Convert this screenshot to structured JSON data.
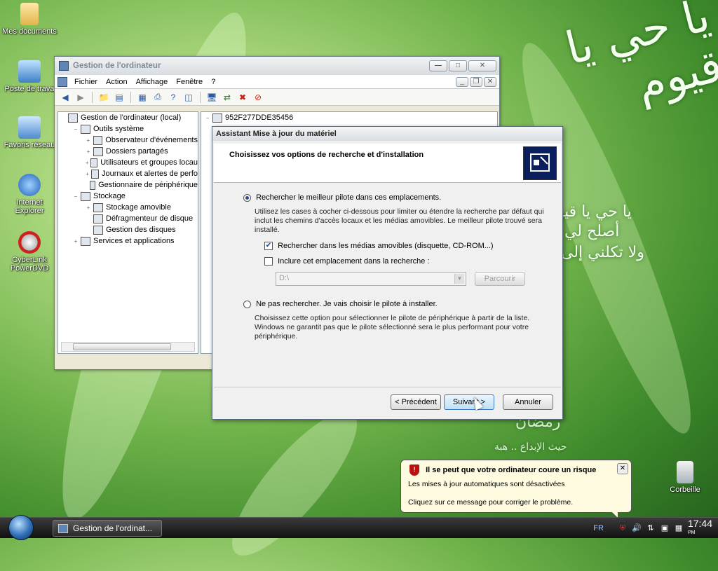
{
  "desktop": {
    "icons": [
      {
        "label": "Mes documents",
        "icon": "folder-icon"
      },
      {
        "label": "Poste de trava",
        "icon": "computer-icon"
      },
      {
        "label": "Favoris réseau",
        "icon": "network-icon"
      },
      {
        "label": "Internet Explorer",
        "icon": "ie-icon"
      },
      {
        "label": "CyberLink PowerDVD",
        "icon": "dvd-icon"
      },
      {
        "label": "Corbeille",
        "icon": "recycle-bin-icon"
      }
    ],
    "arabic_lines": [
      "يا حي يا قيوم",
      "يا حي يا قيوم",
      "أصلح لي",
      "ولا تكلني إلى",
      "رمضان",
      "حيث الإبداع .. هبة"
    ]
  },
  "mmc_window": {
    "title": "Gestion de l'ordinateur",
    "menu": [
      "Fichier",
      "Action",
      "Affichage",
      "Fenêtre",
      "?"
    ],
    "tree": [
      {
        "label": "Gestion de l'ordinateur (local)",
        "level": 0,
        "exp": ""
      },
      {
        "label": "Outils système",
        "level": 1,
        "exp": "−"
      },
      {
        "label": "Observateur d'événements",
        "level": 2,
        "exp": "+"
      },
      {
        "label": "Dossiers partagés",
        "level": 2,
        "exp": "+"
      },
      {
        "label": "Utilisateurs et groupes locau",
        "level": 2,
        "exp": "+"
      },
      {
        "label": "Journaux et alertes de perfo",
        "level": 2,
        "exp": "+"
      },
      {
        "label": "Gestionnaire de périphérique",
        "level": 2,
        "exp": ""
      },
      {
        "label": "Stockage",
        "level": 1,
        "exp": "−"
      },
      {
        "label": "Stockage amovible",
        "level": 2,
        "exp": "+"
      },
      {
        "label": "Défragmenteur de disque",
        "level": 2,
        "exp": ""
      },
      {
        "label": "Gestion des disques",
        "level": 2,
        "exp": ""
      },
      {
        "label": "Services et applications",
        "level": 1,
        "exp": "+"
      }
    ],
    "right_root": "952F277DDE35456"
  },
  "wizard": {
    "title": "Assistant Mise à jour du matériel",
    "heading": "Choisissez vos options de recherche et d'installation",
    "option1": "Rechercher le meilleur pilote dans ces emplacements.",
    "option1_desc": "Utilisez les cases à cocher ci-dessous pour limiter ou étendre la recherche par défaut qui inclut les chemins d'accès locaux et les médias amovibles. Le meilleur pilote trouvé sera installé.",
    "check1": "Rechercher dans les médias amovibles (disquette, CD-ROM...)",
    "check2": "Inclure cet emplacement dans la recherche :",
    "path_value": "D:\\",
    "browse": "Parcourir",
    "option2": "Ne pas rechercher. Je vais choisir le pilote à installer.",
    "option2_desc": "Choisissez cette option pour sélectionner le pilote de périphérique à partir de la liste. Windows ne garantit pas que le pilote sélectionné sera le plus performant pour votre périphérique.",
    "btn_prev": "< Précédent",
    "btn_next": "Suivant >",
    "btn_cancel": "Annuler"
  },
  "balloon": {
    "title": "Il se peut que votre ordinateur coure un risque",
    "line1": "Les mises à jour automatiques sont désactivées",
    "line2": "Cliquez sur ce message pour corriger le problème."
  },
  "taskbar": {
    "task": "Gestion de l'ordinat...",
    "lang": "FR",
    "time": "17:44",
    "ampm": "PM"
  }
}
